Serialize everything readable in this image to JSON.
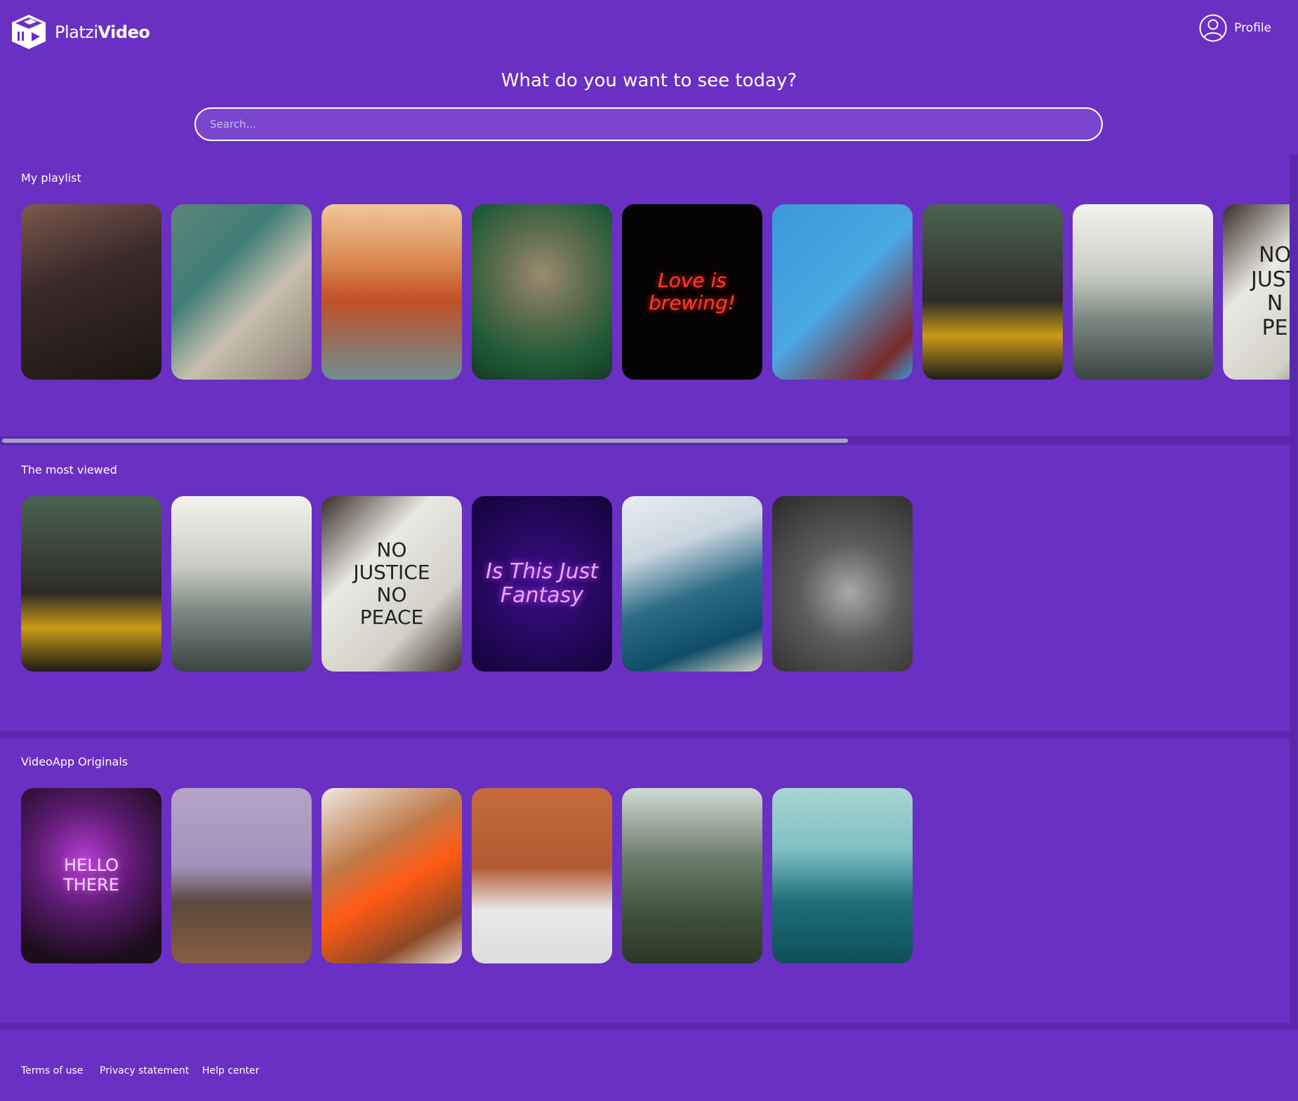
{
  "brand": {
    "name_regular": "Platzi",
    "name_bold": "Video",
    "logo_icon": "cube-play-icon"
  },
  "profile": {
    "label": "Profile",
    "icon": "user-circle-icon"
  },
  "main": {
    "title": "What do you want to see today?"
  },
  "search": {
    "placeholder": "Search..."
  },
  "sections": [
    {
      "title": "My playlist"
    },
    {
      "title": "The most viewed"
    },
    {
      "title": "VideoApp Originals"
    }
  ],
  "cards": {
    "playlist": [
      {
        "subject": "woman-portrait"
      },
      {
        "subject": "beach-rocks"
      },
      {
        "subject": "golden-gate-bridge"
      },
      {
        "subject": "cat"
      },
      {
        "subject": "neon-sign",
        "text": "Love is\nbrewing!"
      },
      {
        "subject": "cassette-hands"
      },
      {
        "subject": "woman-yellow-top"
      },
      {
        "subject": "foggy-bridge"
      },
      {
        "subject": "protest-sign",
        "text": "NO\nJUST\nN\nPE"
      }
    ],
    "most_viewed": [
      {
        "subject": "woman-yellow-top"
      },
      {
        "subject": "foggy-bridge"
      },
      {
        "subject": "protest-sign",
        "text": "NO\nJUSTICE\nNO\nPEACE"
      },
      {
        "subject": "neon-sign",
        "text": "Is This Just\nFantasy"
      },
      {
        "subject": "sailboat"
      },
      {
        "subject": "child-forest"
      }
    ],
    "originals": [
      {
        "subject": "neon-sign",
        "text": "HELLO\nTHERE"
      },
      {
        "subject": "lighthouse"
      },
      {
        "subject": "woman-orange-dress"
      },
      {
        "subject": "ghosts-brick-wall"
      },
      {
        "subject": "forest-trees"
      },
      {
        "subject": "surfer"
      }
    ]
  },
  "footer": {
    "terms": "Terms of use",
    "privacy": "Privacy statement",
    "help": "Help center"
  },
  "colors": {
    "background": "#6a2fc3",
    "divider": "#5a28ad",
    "search_fill": "#7a45cf",
    "text": "#ffffff"
  }
}
